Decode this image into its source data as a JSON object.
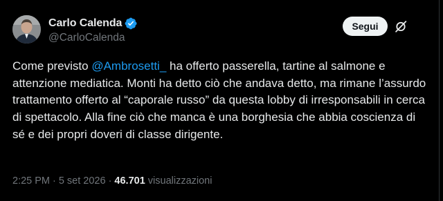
{
  "author": {
    "display_name": "Carlo Calenda",
    "handle": "@CarloCalenda"
  },
  "actions": {
    "follow_label": "Segui",
    "grok_icon": "slashed-circle-icon"
  },
  "tweet": {
    "text_before_mention": "Come previsto ",
    "mention": "@Ambrosetti_",
    "text_after_mention": " ha offerto passerella, tartine al salmone e attenzione mediatica. Monti ha detto ciò che andava detto, ma rimane l’assurdo trattamento offerto al “caporale russo” da questa lobby di irresponsabili in cerca di spettacolo. Alla fine ciò che manca è una borghesia che abbia coscienza di sé e dei propri doveri di classe dirigente."
  },
  "meta": {
    "time": "2:25 PM",
    "separator": "·",
    "date": "5 set 2026",
    "views_count": "46.701",
    "views_label": "visualizzazioni"
  },
  "colors": {
    "background": "#000000",
    "text": "#e7e9ea",
    "muted": "#71767b",
    "accent": "#1d9bf0",
    "button_bg": "#eff3f4"
  }
}
